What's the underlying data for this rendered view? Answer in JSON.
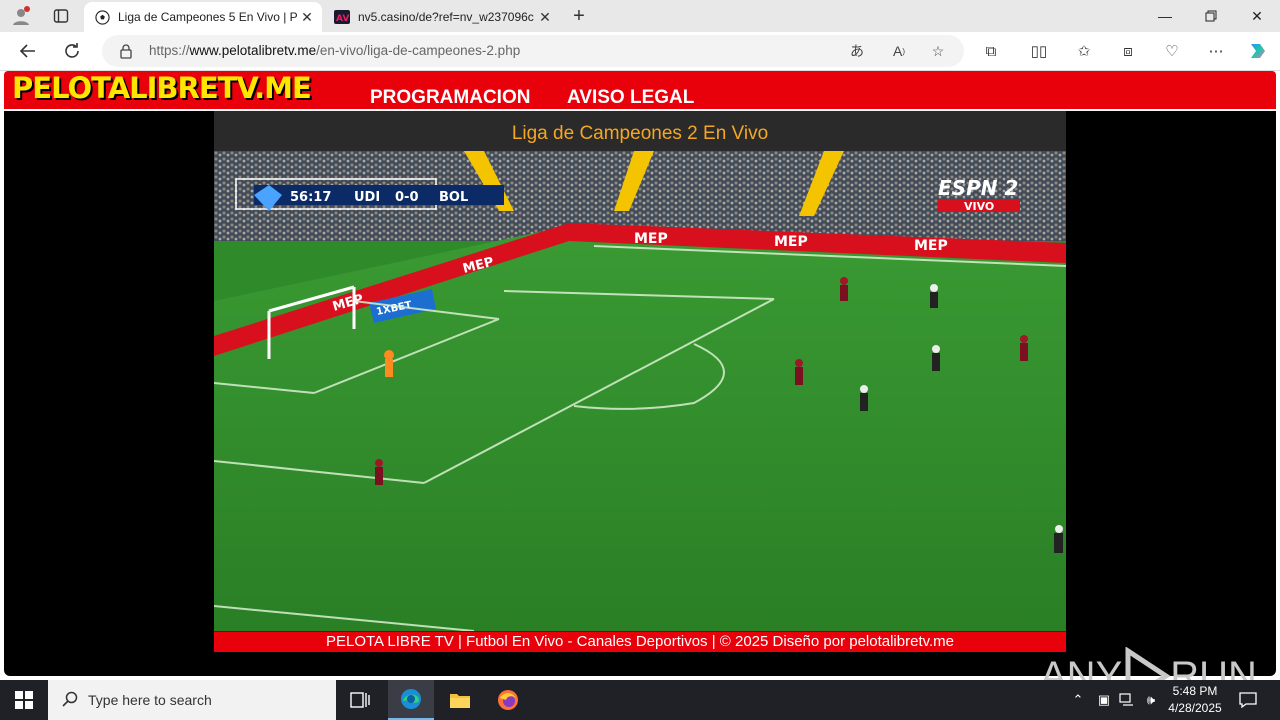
{
  "browser": {
    "tabs": [
      {
        "title": "Liga de Campeones 5 En Vivo | P",
        "active": true
      },
      {
        "title": "nv5.casino/de?ref=nv_w237096c",
        "active": false
      }
    ],
    "url_prefix": "https://",
    "url_host": "www.pelotalibretv.me",
    "url_path": "/en-vivo/liga-de-campeones-2.php"
  },
  "site": {
    "logo": "PELOTALIBRETV.ME",
    "menu": [
      "PROGRAMACION",
      "AVISO LEGAL"
    ],
    "player_title": "Liga de Campeones 2 En Vivo",
    "footer": "PELOTA LIBRE TV | Futbol En Vivo - Canales Deportivos | © 2025 Diseño por pelotalibretv.me"
  },
  "video": {
    "scoreboard_time": "56:17",
    "home_team": "UDI",
    "score": "0-0",
    "away_team": "BOL",
    "channel_logo": "ESPN 2",
    "channel_badge": "VIVO",
    "ad_text": "MEP",
    "board_text": "1XBET"
  },
  "watermark": {
    "left": "ANY",
    "right": "RUN"
  },
  "taskbar": {
    "search_placeholder": "Type here to search",
    "time": "5:48 PM",
    "date": "4/28/2025"
  },
  "colors": {
    "site_red": "#e8000b",
    "logo_yellow": "#ffe600",
    "title_orange": "#f5a623",
    "pitch_green": "#2f8a2a"
  }
}
